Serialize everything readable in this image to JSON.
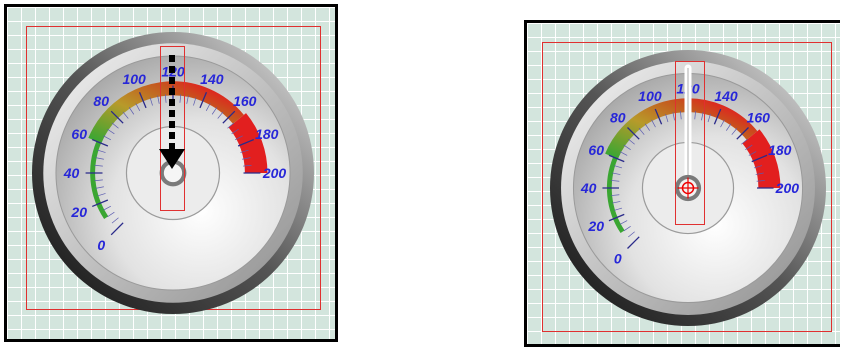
{
  "gauges": [
    {
      "min": 0,
      "max": 200,
      "value": 120,
      "tick_labels": [
        "0",
        "20",
        "40",
        "60",
        "80",
        "100",
        "120",
        "140",
        "160",
        "180",
        "200"
      ],
      "colors": {
        "low": "#3aa632",
        "mid": "#b89a2a",
        "high": "#e21f1f",
        "label": "#2727d8"
      },
      "state": "dragging-needle",
      "needle_visible": false
    },
    {
      "min": 0,
      "max": 200,
      "value": 120,
      "tick_labels": [
        "0",
        "20",
        "40",
        "60",
        "80",
        "100",
        "120",
        "140",
        "160",
        "180",
        "200"
      ],
      "colors": {
        "low": "#3aa632",
        "mid": "#b89a2a",
        "high": "#e21f1f",
        "label": "#2727d8"
      },
      "state": "needle-placed",
      "needle_visible": true
    }
  ],
  "icons": {
    "drag": "dashed-down-arrow-icon",
    "pivot": "crosshair-icon"
  }
}
